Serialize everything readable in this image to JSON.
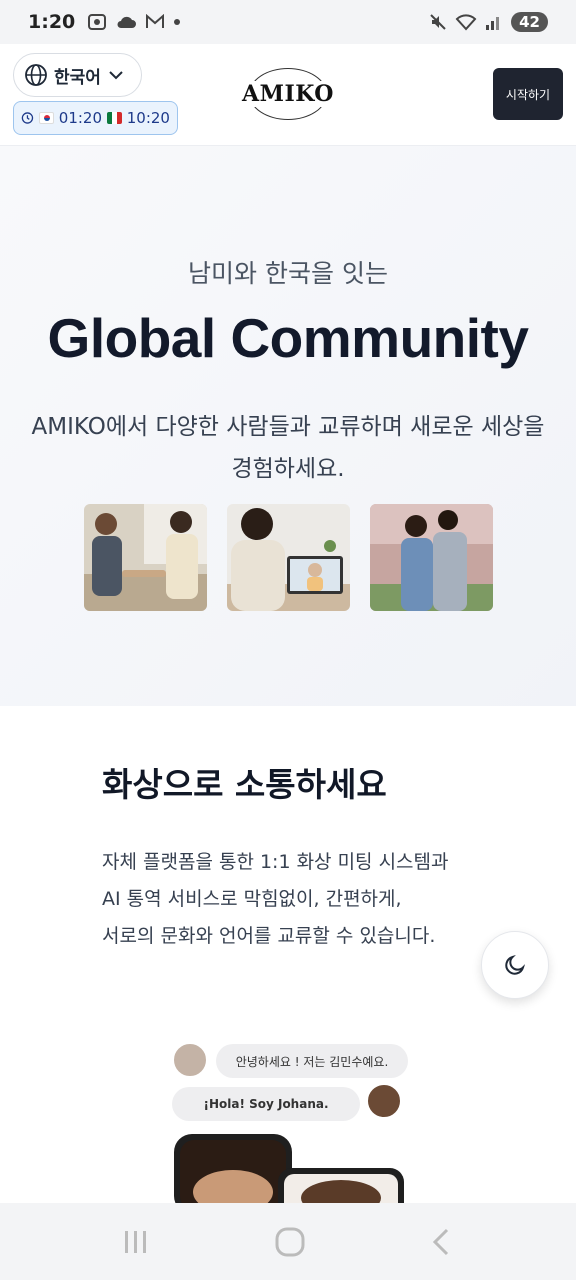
{
  "status_bar": {
    "time": "1:20",
    "battery": "42"
  },
  "header": {
    "language": "한국어",
    "kr_time": "01:20",
    "mx_time": "10:20",
    "logo_text": "AMIKO",
    "start_button": "시작하기"
  },
  "hero": {
    "subtitle": "남미와 한국을 잇는",
    "title": "Global Community",
    "description": "AMIKO에서 다양한 사람들과 교류하며 새로운 세상을 경험하세요."
  },
  "video_section": {
    "title": "화상으로 소통하세요",
    "description_lines": [
      "자체 플랫폼을 통한 1:1 화상 미팅 시스템과",
      "AI 통역 서비스로 막힘없이, 간편하게,",
      "서로의 문화와 언어를 교류할 수 있습니다."
    ],
    "chat_bubble_ko": "안녕하세요 ! 저는 김민수예요.",
    "chat_bubble_es": "¡Hola! Soy Johana."
  },
  "colors": {
    "accent_dark": "#1f2430",
    "title": "#131a2b",
    "badge_border": "#9ec5ee"
  }
}
